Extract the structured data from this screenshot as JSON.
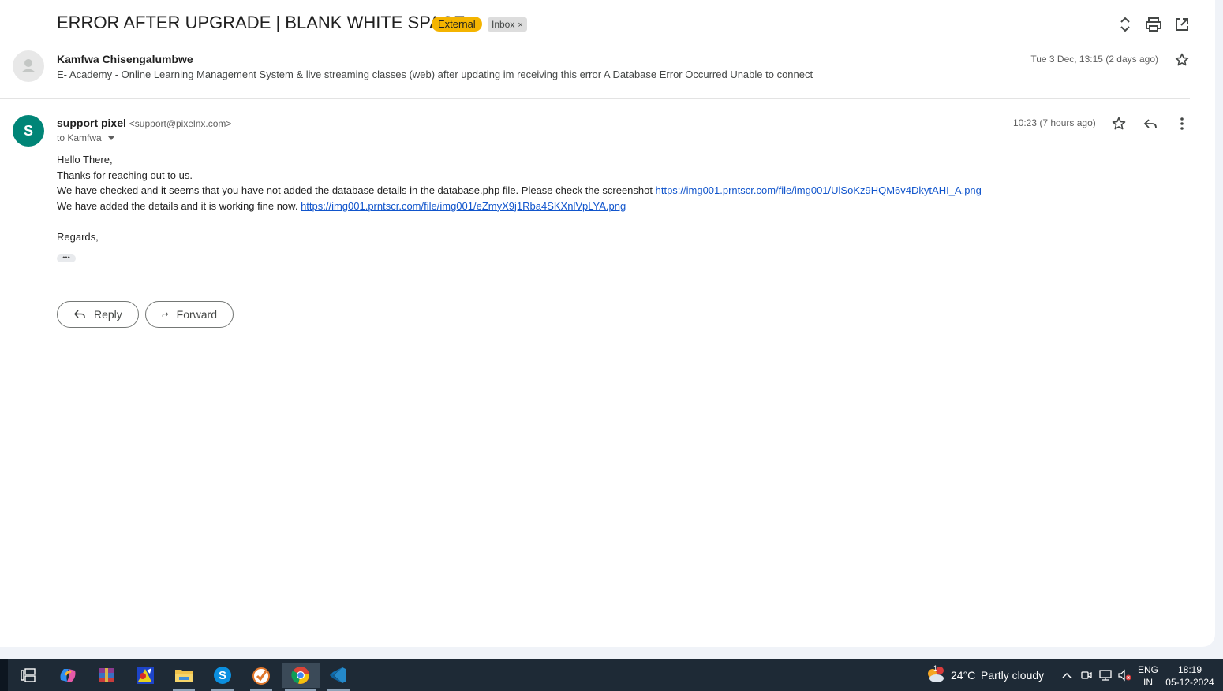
{
  "thread": {
    "subject": "ERROR AFTER UPGRADE | BLANK WHITE SPACE",
    "labels": {
      "external": "External",
      "inbox": "Inbox",
      "inbox_remove": "×"
    }
  },
  "messages": [
    {
      "sender": "Kamfwa Chisengalumbwe",
      "date": "Tue 3 Dec, 13:15 (2 days ago)",
      "snippet": "E- Academy - Online Learning Management System & live streaming classes (web) after updating im receiving this error A Database Error Occurred Unable to connect"
    },
    {
      "avatar_letter": "S",
      "sender": "support pixel",
      "email": "<support@pixelnx.com>",
      "to": "to Kamfwa",
      "date": "10:23 (7 hours ago)",
      "body": {
        "greeting": "Hello There,",
        "line1": "Thanks for reaching out to us.",
        "line2": "We have checked and it seems that you have not added the database details in the database.php file. Please check the screenshot ",
        "link1": "https://img001.prntscr.com/file/img001/UlSoKz9HQM6v4DkytAHI_A.png",
        "line3": "We have added the details and it is working fine now. ",
        "link2": "https://img001.prntscr.com/file/img001/eZmyX9j1Rba4SKXnlVpLYA.png",
        "closing": "Regards,"
      },
      "trimmed_content": "•••"
    }
  ],
  "actions": {
    "reply": "Reply",
    "forward": "Forward"
  },
  "taskbar": {
    "apps": [
      "task-view",
      "copilot",
      "winrar",
      "paint",
      "file-explorer",
      "skype",
      "todo",
      "chrome",
      "vscode"
    ],
    "weather": {
      "temp": "24°C",
      "condition": "Partly cloudy",
      "alert_count": "1"
    },
    "language": {
      "lang": "ENG",
      "region": "IN"
    },
    "clock": {
      "time": "18:19",
      "date": "05-12-2024"
    }
  },
  "colors": {
    "external_badge": "#f4b400",
    "avatar_support": "#008577",
    "link": "#1155cc",
    "taskbar": "#1e2a36"
  }
}
